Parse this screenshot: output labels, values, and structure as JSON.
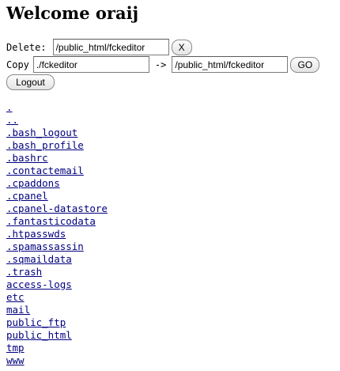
{
  "page": {
    "heading": "Welcome oraij"
  },
  "delete_form": {
    "label": "Delete:",
    "path_value": "/public_html/fckeditor",
    "button_label": "X"
  },
  "copy_form": {
    "label": "Copy",
    "source_value": "./fckeditor",
    "arrow": "->",
    "dest_value": "/public_html/fckeditor",
    "button_label": "GO"
  },
  "logout": {
    "button_label": "Logout"
  },
  "files": [
    ".",
    "..",
    ".bash_logout",
    ".bash_profile",
    ".bashrc",
    ".contactemail",
    ".cpaddons",
    ".cpanel",
    ".cpanel-datastore",
    ".fantasticodata",
    ".htpasswds",
    ".spamassassin",
    ".sqmaildata",
    ".trash",
    "access-logs",
    "etc",
    "mail",
    "public_ftp",
    "public_html",
    "tmp",
    "www"
  ]
}
